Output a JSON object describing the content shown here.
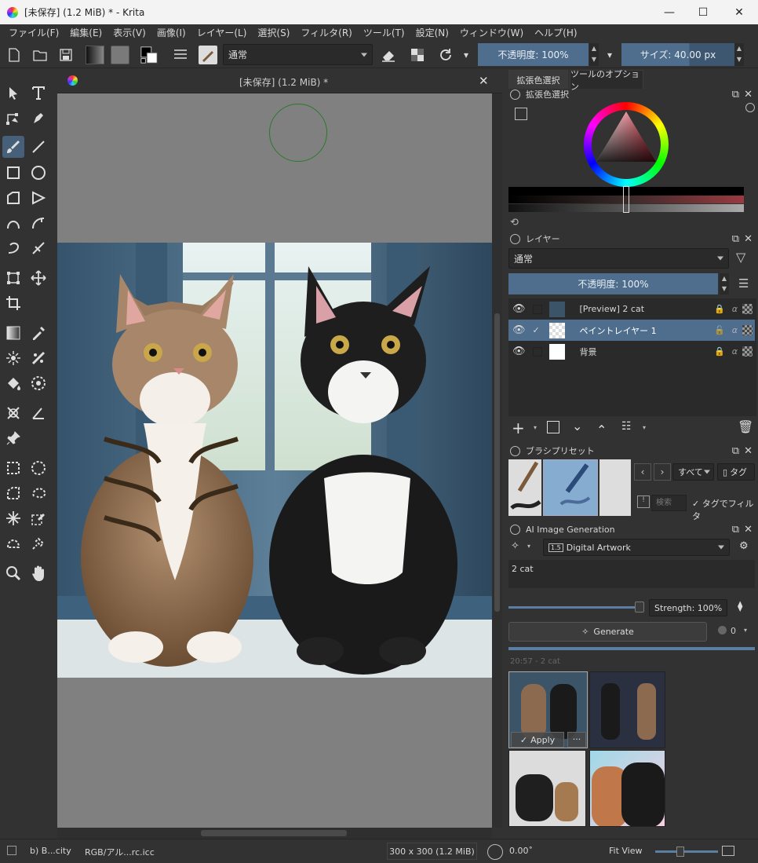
{
  "window": {
    "title": "[未保存]  (1.2 MiB) * - Krita",
    "minimize": "—",
    "maximize": "☐",
    "close": "✕"
  },
  "menu": [
    "ファイル(F)",
    "編集(E)",
    "表示(V)",
    "画像(I)",
    "レイヤー(L)",
    "選択(S)",
    "フィルタ(R)",
    "ツール(T)",
    "設定(N)",
    "ウィンドウ(W)",
    "ヘルプ(H)"
  ],
  "toolbar": {
    "blend_mode": "通常",
    "opacity": "不透明度: 100%",
    "size": "サイズ: 40.00 px"
  },
  "document_tab": {
    "title": "[未保存]  (1.2 MiB) *",
    "close": "✕"
  },
  "dock_tabs": [
    "拡張色選択",
    "ツールのオプション"
  ],
  "color_selector": {
    "title": "拡張色選択"
  },
  "layers_panel": {
    "title": "レイヤー",
    "blend_mode": "通常",
    "opacity": "不透明度:  100%",
    "layers": [
      {
        "name": "[Preview] 2 cat",
        "visible": true,
        "checked": false,
        "selected": false
      },
      {
        "name": "ペイントレイヤー 1",
        "visible": true,
        "checked": true,
        "selected": true
      },
      {
        "name": "背景",
        "visible": true,
        "checked": false,
        "selected": false
      }
    ]
  },
  "brush_presets": {
    "title": "ブラシプリセット",
    "filter_all": "すべて",
    "tag": "タグ",
    "search_placeholder": "検索",
    "tag_filter": "タグでフィルタ"
  },
  "ai_panel": {
    "title": "AI Image Generation",
    "style": "Digital Artwork",
    "prompt": "2 cat",
    "strength": "Strength: 100%",
    "generate": "Generate",
    "queue_count": "0",
    "history_label": "20:57 - 2 cat",
    "apply": "Apply",
    "more": "···"
  },
  "statusbar": {
    "brush": "b) B...city",
    "color_profile": "RGB/アル...rc.icc",
    "image_size": "300 x 300 (1.2 MiB)",
    "rotation": "0.00˚",
    "zoom_mode": "Fit View"
  },
  "colors": {
    "accent": "#4f6e8d",
    "selection": "#46607a",
    "panel": "#323232",
    "canvas_bg": "#808080"
  }
}
